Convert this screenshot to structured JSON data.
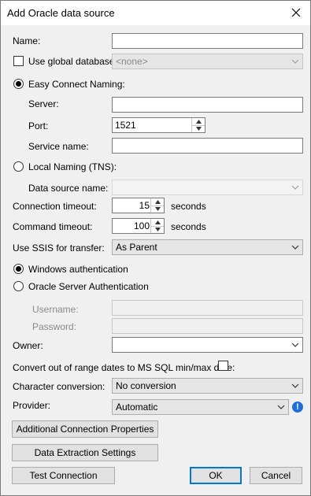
{
  "window": {
    "title": "Add Oracle data source"
  },
  "fields": {
    "name_label": "Name:",
    "use_global_db_label": "Use global database:",
    "global_db_value": "<none>",
    "easy_connect_label": "Easy Connect Naming:",
    "server_label": "Server:",
    "port_label": "Port:",
    "port_value": "1521",
    "service_name_label": "Service name:",
    "local_naming_label": "Local Naming (TNS):",
    "data_source_name_label": "Data source name:",
    "connection_timeout_label": "Connection timeout:",
    "connection_timeout_value": "15",
    "seconds_label_1": "seconds",
    "command_timeout_label": "Command timeout:",
    "command_timeout_value": "100",
    "seconds_label_2": "seconds",
    "use_ssis_label": "Use SSIS for transfer:",
    "use_ssis_value": "As Parent",
    "windows_auth_label": "Windows authentication",
    "oracle_auth_label": "Oracle Server Authentication",
    "username_label": "Username:",
    "password_label": "Password:",
    "owner_label": "Owner:",
    "convert_dates_label": "Convert out of range dates to MS SQL min/max date:",
    "char_conversion_label": "Character conversion:",
    "char_conversion_value": "No conversion",
    "provider_label": "Provider:",
    "provider_value": "Automatic"
  },
  "buttons": {
    "additional_props": "Additional Connection Properties",
    "data_extraction": "Data Extraction Settings",
    "test_connection": "Test Connection",
    "ok": "OK",
    "cancel": "Cancel"
  },
  "icons": {
    "close": "close-icon",
    "info": "info-icon",
    "info_glyph": "!"
  },
  "colors": {
    "accent": "#0078d7",
    "info_blue": "#1f6fd6"
  }
}
